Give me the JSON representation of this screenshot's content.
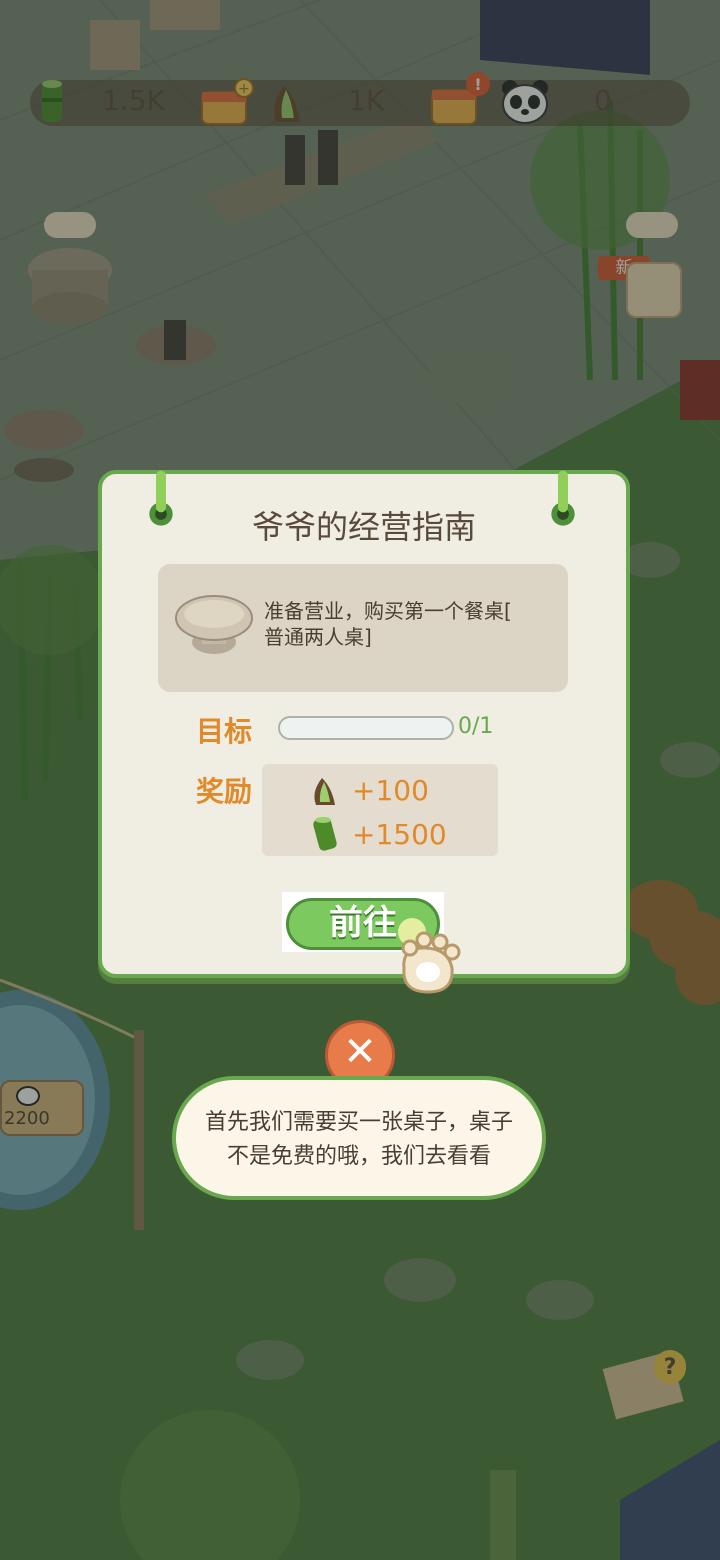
{
  "hud": {
    "bamboo_count": "1.5K",
    "shoot_count": "1K",
    "panda_count": "0"
  },
  "scene": {
    "new_badge": "新",
    "sign_value": "2200"
  },
  "guide": {
    "title": "爷爷的经营指南",
    "task_text_line1": "准备营业，购买第一个餐桌[",
    "task_text_line2": "普通两人桌]",
    "goal_label": "目标",
    "goal_progress": 0,
    "goal_total": 1,
    "goal_text": "0/1",
    "reward_label": "奖励",
    "rewards": [
      {
        "icon": "bamboo-shoot-icon",
        "amount": "+100"
      },
      {
        "icon": "bamboo-stalk-icon",
        "amount": "+1500"
      }
    ],
    "go_button": "前往"
  },
  "tip": {
    "line1": "首先我们需要买一张桌子，桌子",
    "line2": "不是免费的哦，我们去看看"
  },
  "colors": {
    "accent_green": "#6aa84f",
    "reward_orange": "#e08a2a",
    "close_red": "#e77b4a"
  }
}
